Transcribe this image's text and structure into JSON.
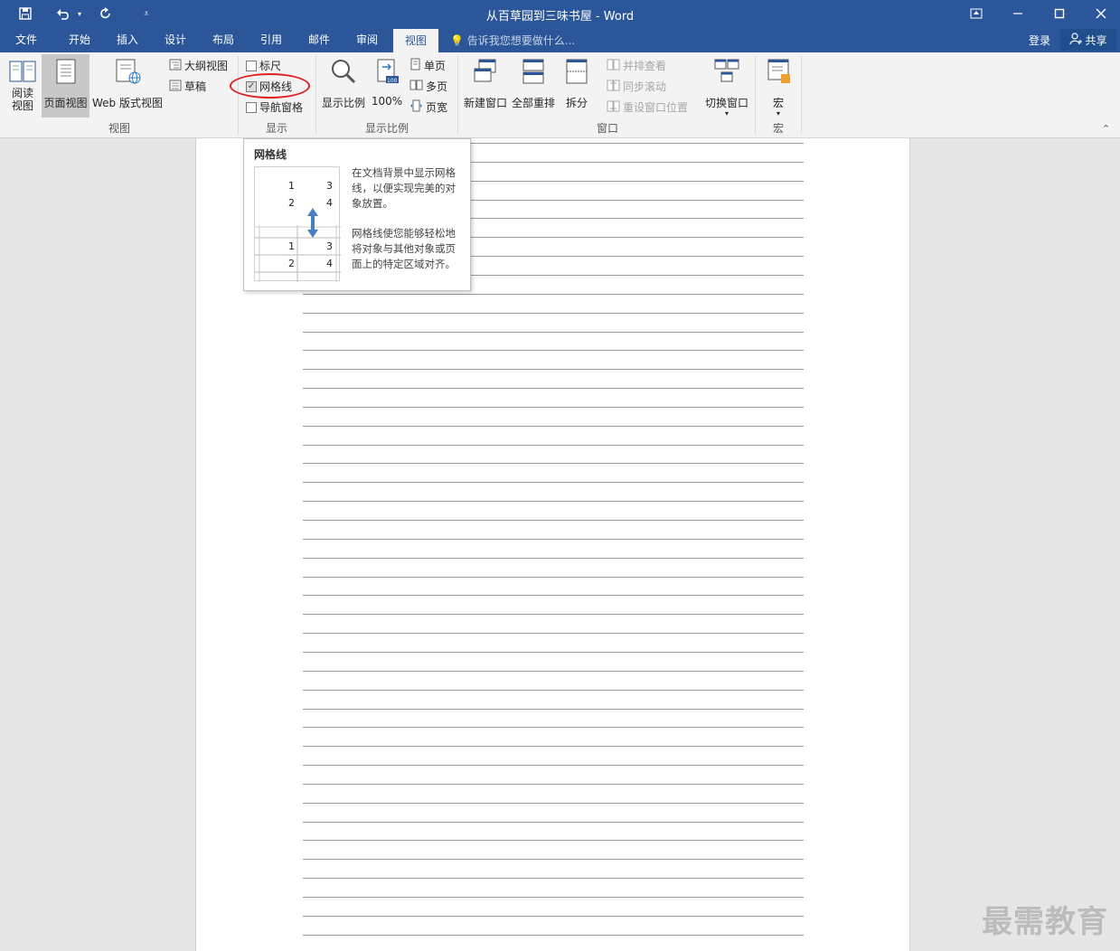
{
  "window": {
    "title": "从百草园到三味书屋 - Word",
    "quick_access": {
      "save_icon": "save-icon",
      "undo_icon": "undo-icon",
      "redo_icon": "redo-icon",
      "customize_icon": "customize-icon"
    }
  },
  "tabs": [
    {
      "label": "文件"
    },
    {
      "label": "开始"
    },
    {
      "label": "插入"
    },
    {
      "label": "设计"
    },
    {
      "label": "布局"
    },
    {
      "label": "引用"
    },
    {
      "label": "邮件"
    },
    {
      "label": "审阅"
    },
    {
      "label": "视图",
      "active": true
    }
  ],
  "tellme": {
    "placeholder": "告诉我您想要做什么..."
  },
  "account": {
    "login": "登录",
    "share": "共享"
  },
  "ribbon": {
    "views": {
      "read_mode": "阅读\n视图",
      "print_layout": "页面视图",
      "web_layout": "Web 版式视图",
      "outline": "大纲视图",
      "draft": "草稿",
      "label": "视图"
    },
    "show": {
      "ruler": "标尺",
      "gridlines": "网格线",
      "nav_pane": "导航窗格",
      "label": "显示",
      "gridlines_checked": true
    },
    "zoom": {
      "zoom": "显示比例",
      "hundred": "100%",
      "one_page": "单页",
      "multi_page": "多页",
      "page_width": "页宽",
      "label": "显示比例"
    },
    "window": {
      "new_window": "新建窗口",
      "arrange_all": "全部重排",
      "split": "拆分",
      "side_by_side": "并排查看",
      "sync_scroll": "同步滚动",
      "reset_position": "重设窗口位置",
      "switch_windows": "切换窗口",
      "label": "窗口"
    },
    "macros": {
      "macros": "宏",
      "label": "宏"
    }
  },
  "tooltip": {
    "title": "网格线",
    "para1": "在文档背景中显示网格线，以便实现完美的对象放置。",
    "para2": "网格线使您能够轻松地将对象与其他对象或页面上的特定区域对齐。",
    "nums": [
      "1",
      "3",
      "2",
      "4",
      "1",
      "3",
      "2",
      "4"
    ]
  },
  "watermark": "最需教育"
}
